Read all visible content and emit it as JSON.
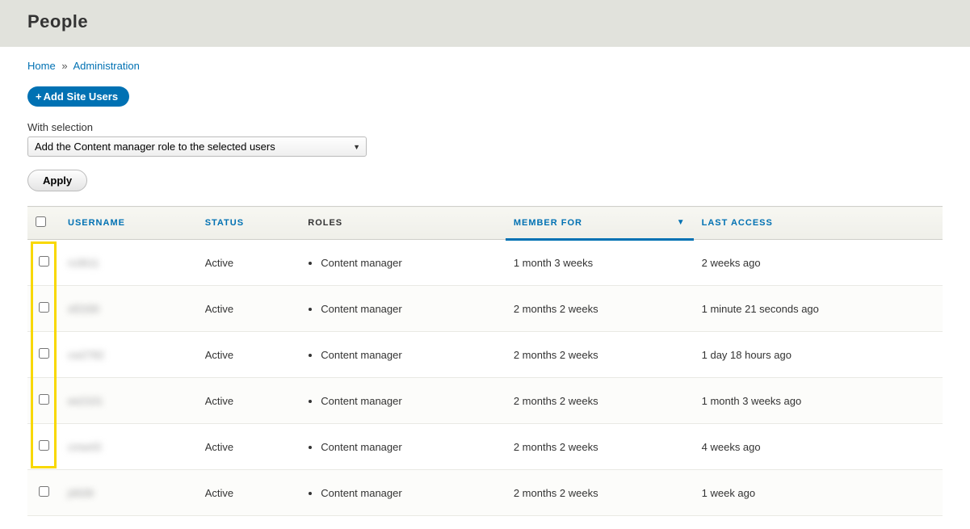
{
  "header": {
    "title": "People"
  },
  "breadcrumb": {
    "home": "Home",
    "admin": "Administration",
    "sep": "»"
  },
  "actions": {
    "add_button": "Add Site Users",
    "with_selection_label": "With selection",
    "selected_action": "Add the Content manager role to the selected users",
    "apply": "Apply"
  },
  "table": {
    "headers": {
      "username": "USERNAME",
      "status": "STATUS",
      "roles": "ROLES",
      "member_for": "MEMBER FOR",
      "last_access": "LAST ACCESS"
    },
    "rows": [
      {
        "username": "rs3611",
        "status": "Active",
        "roles": [
          "Content manager"
        ],
        "member_for": "1 month 3 weeks",
        "last_access": "2 weeks ago"
      },
      {
        "username": "sf2330",
        "status": "Active",
        "roles": [
          "Content manager"
        ],
        "member_for": "2 months 2 weeks",
        "last_access": "1 minute 21 seconds ago"
      },
      {
        "username": "cw2782",
        "status": "Active",
        "roles": [
          "Content manager"
        ],
        "member_for": "2 months 2 weeks",
        "last_access": "1 day 18 hours ago"
      },
      {
        "username": "ee2101",
        "status": "Active",
        "roles": [
          "Content manager"
        ],
        "member_for": "2 months 2 weeks",
        "last_access": "1 month 3 weeks ago"
      },
      {
        "username": "cmw43",
        "status": "Active",
        "roles": [
          "Content manager"
        ],
        "member_for": "2 months 2 weeks",
        "last_access": "4 weeks ago"
      },
      {
        "username": "j4639",
        "status": "Active",
        "roles": [
          "Content manager"
        ],
        "member_for": "2 months 2 weeks",
        "last_access": "1 week ago"
      }
    ]
  }
}
